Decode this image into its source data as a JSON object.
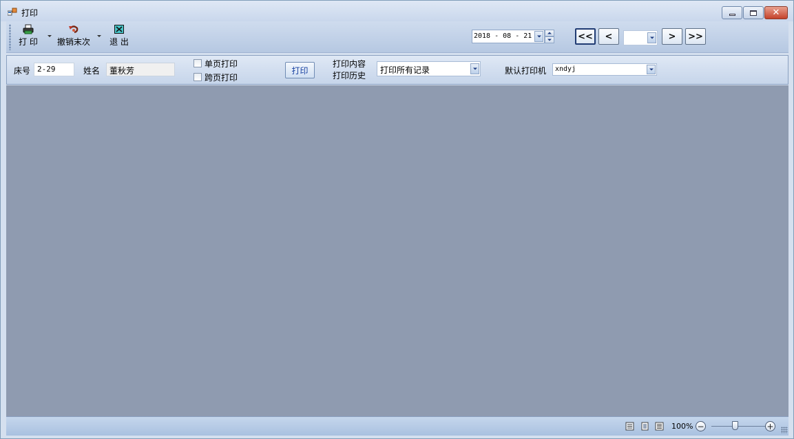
{
  "window": {
    "title": "打印"
  },
  "toolbar": {
    "print_label": "打 印",
    "undo_label": "撤销末次",
    "exit_label": "退 出",
    "date_value": "2018 - 08 - 21",
    "nav_first": "<<",
    "nav_prev": "<",
    "nav_next": ">",
    "nav_last": ">>",
    "page_value": ""
  },
  "filter": {
    "bed_label": "床号",
    "bed_value": "2-29",
    "name_label": "姓名",
    "name_value": "董秋芳",
    "single_page_label": "单页打印",
    "cross_page_label": "跨页打印",
    "print_button": "打印",
    "content_label": "打印内容",
    "history_label": "打印历史",
    "content_value": "打印所有记录",
    "printer_label": "默认打印机",
    "printer_value": "xndyj"
  },
  "statusbar": {
    "zoom": "100%",
    "zoom_level_percent": 100
  },
  "colors": {
    "preview_bg": "#8f9bb0",
    "accent": "#1f3a72"
  }
}
